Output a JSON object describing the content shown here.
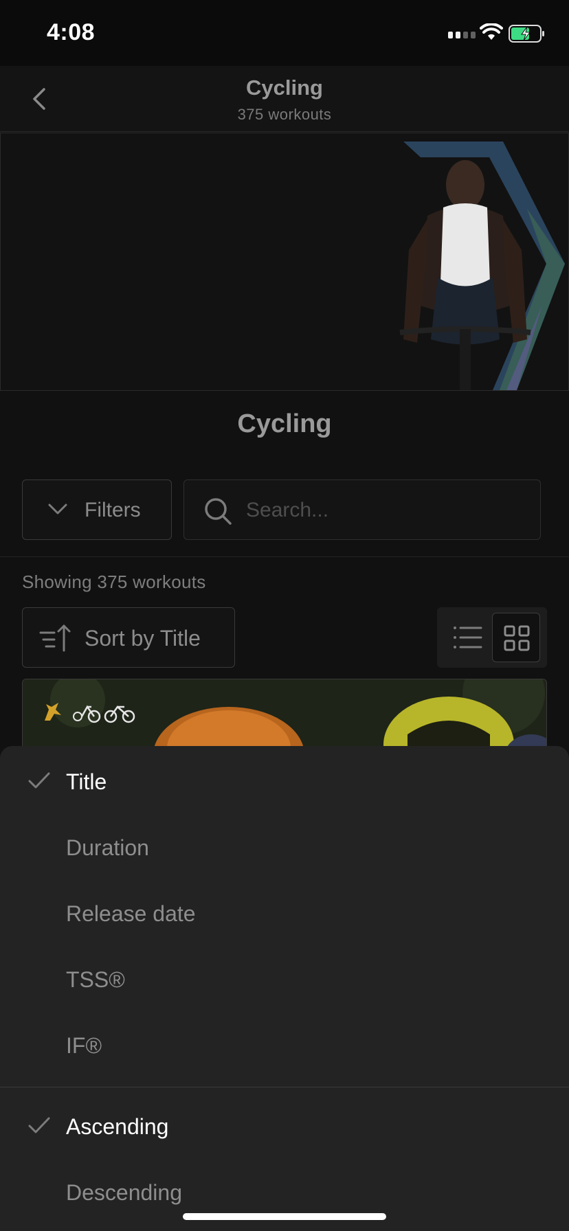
{
  "status_bar": {
    "time": "4:08"
  },
  "nav": {
    "title": "Cycling",
    "subtitle": "375 workouts"
  },
  "section": {
    "title": "Cycling"
  },
  "filters": {
    "label": "Filters"
  },
  "search": {
    "placeholder": "Search..."
  },
  "results": {
    "showing_text": "Showing 375 workouts"
  },
  "sort": {
    "label": "Sort by Title"
  },
  "view_mode": {
    "selected": "grid"
  },
  "sort_sheet": {
    "fields": [
      {
        "label": "Title",
        "selected": true
      },
      {
        "label": "Duration",
        "selected": false
      },
      {
        "label": "Release date",
        "selected": false
      },
      {
        "label": "TSS®",
        "selected": false
      },
      {
        "label": "IF®",
        "selected": false
      }
    ],
    "order": [
      {
        "label": "Ascending",
        "selected": true
      },
      {
        "label": "Descending",
        "selected": false
      }
    ]
  },
  "colors": {
    "background": "#111111",
    "sheet": "#232323",
    "accent_green": "#3ddc84"
  }
}
